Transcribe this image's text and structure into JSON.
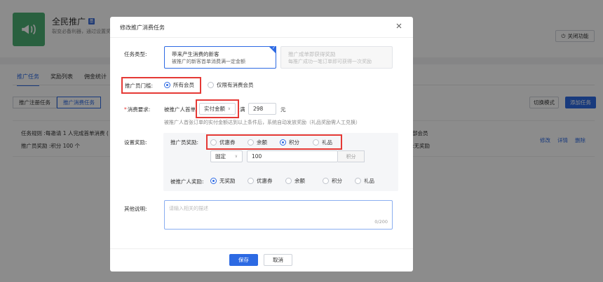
{
  "app": {
    "title": "全民推广",
    "badge": "基",
    "desc": "裂变必备利器，通过设置奖",
    "close_feature": "关闭功能"
  },
  "main_tabs": [
    {
      "label": "推广任务",
      "active": true
    },
    {
      "label": "奖励列表",
      "active": false
    },
    {
      "label": "佣金统计",
      "active": false
    }
  ],
  "sub_tabs": [
    {
      "label": "推广注册任务",
      "active": false
    },
    {
      "label": "推广消费任务",
      "active": true
    }
  ],
  "toolbar": {
    "switch_mode": "切换模式",
    "add_task": "添加任务"
  },
  "task": {
    "rule": "任务规则 :每邀请 1 人完成首单消费 (",
    "reward": "推广员奖励 :积分 100 个",
    "right1": "部会员",
    "right2": ":无奖励",
    "ops": [
      "修改",
      "详情",
      "删除"
    ]
  },
  "modal": {
    "title": "修改推广消费任务",
    "task_type_label": "任务类型:",
    "type_cards": [
      {
        "line1": "带来产生消费的新客",
        "line2": "被推广的新客首单消费满一定金额",
        "selected": true
      },
      {
        "line1": "推广成单即获得奖励",
        "line2": "每推广成功一笔订单即可获得一次奖励",
        "selected": false
      }
    ],
    "threshold_label": "推广员门槛:",
    "threshold_options": [
      {
        "label": "所有会员",
        "checked": true
      },
      {
        "label": "仅限有消费会员",
        "checked": false
      }
    ],
    "consume_label": "消费要求:",
    "consume_prefix": "被推广人首单",
    "consume_select": "实付金额",
    "consume_mid": "满",
    "consume_value": "298",
    "consume_unit": "元",
    "consume_hint": "被推广人首张订单的实付金额达到以上条件后，系统自动发放奖励（礼品奖励需人工兑换）",
    "reward_label": "设置奖励:",
    "promoter_reward_label": "推广员奖励:",
    "promoter_reward_options": [
      {
        "label": "优惠券",
        "checked": false
      },
      {
        "label": "余额",
        "checked": false
      },
      {
        "label": "积分",
        "checked": true
      },
      {
        "label": "礼品",
        "checked": false
      }
    ],
    "points_mode": "固定",
    "points_value": "100",
    "points_unit": "积分",
    "invitee_reward_label": "被推广人奖励:",
    "invitee_reward_options": [
      {
        "label": "无奖励",
        "checked": true
      },
      {
        "label": "优惠券",
        "checked": false
      },
      {
        "label": "余额",
        "checked": false
      },
      {
        "label": "积分",
        "checked": false
      },
      {
        "label": "礼品",
        "checked": false
      }
    ],
    "note_label": "其他说明:",
    "note_placeholder": "请输入相关的描述",
    "note_count": "0/200",
    "save": "保存",
    "cancel": "取消"
  },
  "colors": {
    "primary": "#2d6ae3",
    "highlight": "#e53935",
    "logo_green": "#4caf73"
  }
}
